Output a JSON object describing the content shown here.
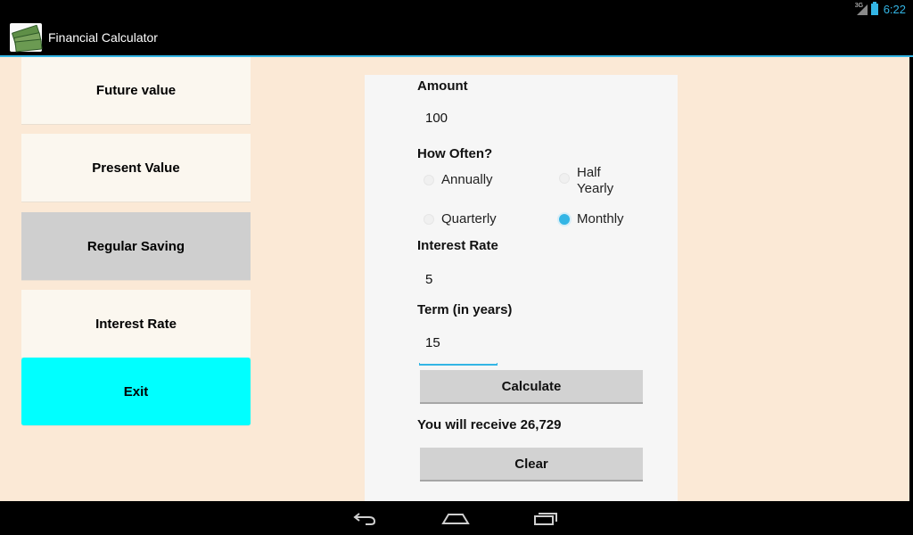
{
  "status_bar": {
    "network": "3G",
    "time": "6:22",
    "accent_color": "#33b5e5"
  },
  "app": {
    "title": "Financial Calculator",
    "icon": "money-icon"
  },
  "menu": {
    "items": [
      {
        "label": "Future value"
      },
      {
        "label": "Present Value"
      },
      {
        "label": "Regular Saving"
      },
      {
        "label": "Interest Rate"
      },
      {
        "label": "Exit"
      }
    ],
    "selected": "Regular Saving"
  },
  "form": {
    "amount_label": "Amount",
    "amount_value": "100",
    "frequency_label": "How Often?",
    "options": [
      {
        "label": "Annually",
        "selected": false
      },
      {
        "label": "Half Yearly",
        "selected": false
      },
      {
        "label": "Quarterly",
        "selected": false
      },
      {
        "label": "Monthly",
        "selected": true
      }
    ],
    "rate_label": "Interest Rate",
    "rate_value": "5",
    "term_label": "Term (in years)",
    "term_value": "15",
    "calculate_label": "Calculate",
    "result_text": "You will receive 26,729",
    "clear_label": "Clear"
  },
  "nav": {
    "back_icon": "back-icon",
    "home_icon": "home-icon",
    "recents_icon": "recents-icon"
  }
}
